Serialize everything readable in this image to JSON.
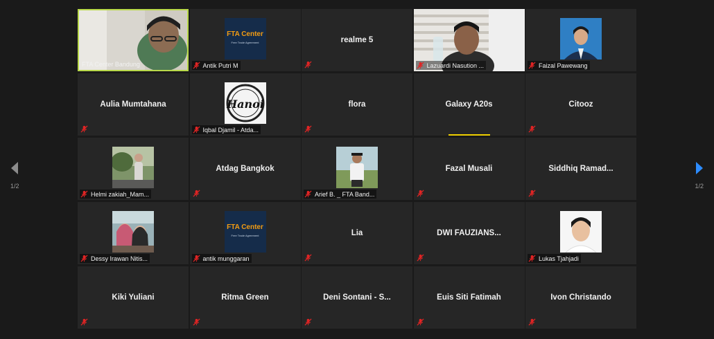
{
  "participants": [
    {
      "name": "FTA Center Bandung",
      "display": "video",
      "active": true
    },
    {
      "name": "Antik Putri M",
      "display": "fta-logo"
    },
    {
      "name": "realme 5",
      "display": "name"
    },
    {
      "name": "Lazuardi Nasution ...",
      "display": "video"
    },
    {
      "name": "Faizal Pawewang",
      "display": "photo"
    },
    {
      "name": "Aulia Mumtahana",
      "display": "name"
    },
    {
      "name": "Iqbal Djamil - Atda...",
      "display": "hanoi-logo",
      "logo_text": "Hanoi"
    },
    {
      "name": "flora",
      "display": "name"
    },
    {
      "name": "Galaxy A20s",
      "display": "name",
      "speaking": true
    },
    {
      "name": "Citooz",
      "display": "name"
    },
    {
      "name": "Helmi zakiah_Mam...",
      "display": "photo"
    },
    {
      "name": "Atdag Bangkok",
      "display": "name"
    },
    {
      "name": "Arief B. _ FTA Band...",
      "display": "photo"
    },
    {
      "name": "Fazal Musali",
      "display": "name"
    },
    {
      "name": "Siddhiq  Ramad...",
      "display": "name"
    },
    {
      "name": "Dessy Irawan Nitis...",
      "display": "photo"
    },
    {
      "name": "antik munggaran",
      "display": "fta-logo"
    },
    {
      "name": "Lia",
      "display": "name"
    },
    {
      "name": "DWI FAUZIANS...",
      "display": "name"
    },
    {
      "name": "Lukas Tjahjadi",
      "display": "photo"
    },
    {
      "name": "Kiki Yuliani",
      "display": "name"
    },
    {
      "name": "Ritma Green",
      "display": "name"
    },
    {
      "name": "Deni Sontani  - S...",
      "display": "name"
    },
    {
      "name": "Euis Siti Fatimah",
      "display": "name"
    },
    {
      "name": "Ivon Christando",
      "display": "name"
    }
  ],
  "fta_logo": {
    "title": "FTA Center",
    "subtitle": "Free Trade Agreement"
  },
  "pagination": {
    "left": "1/2",
    "right": "1/2"
  },
  "colors": {
    "active_border": "#b9d94a",
    "speaking_bar": "#f0d000",
    "mute_icon": "#e02424",
    "next_arrow": "#2d8cff",
    "tile": "#262626",
    "background": "#1a1a1a"
  }
}
